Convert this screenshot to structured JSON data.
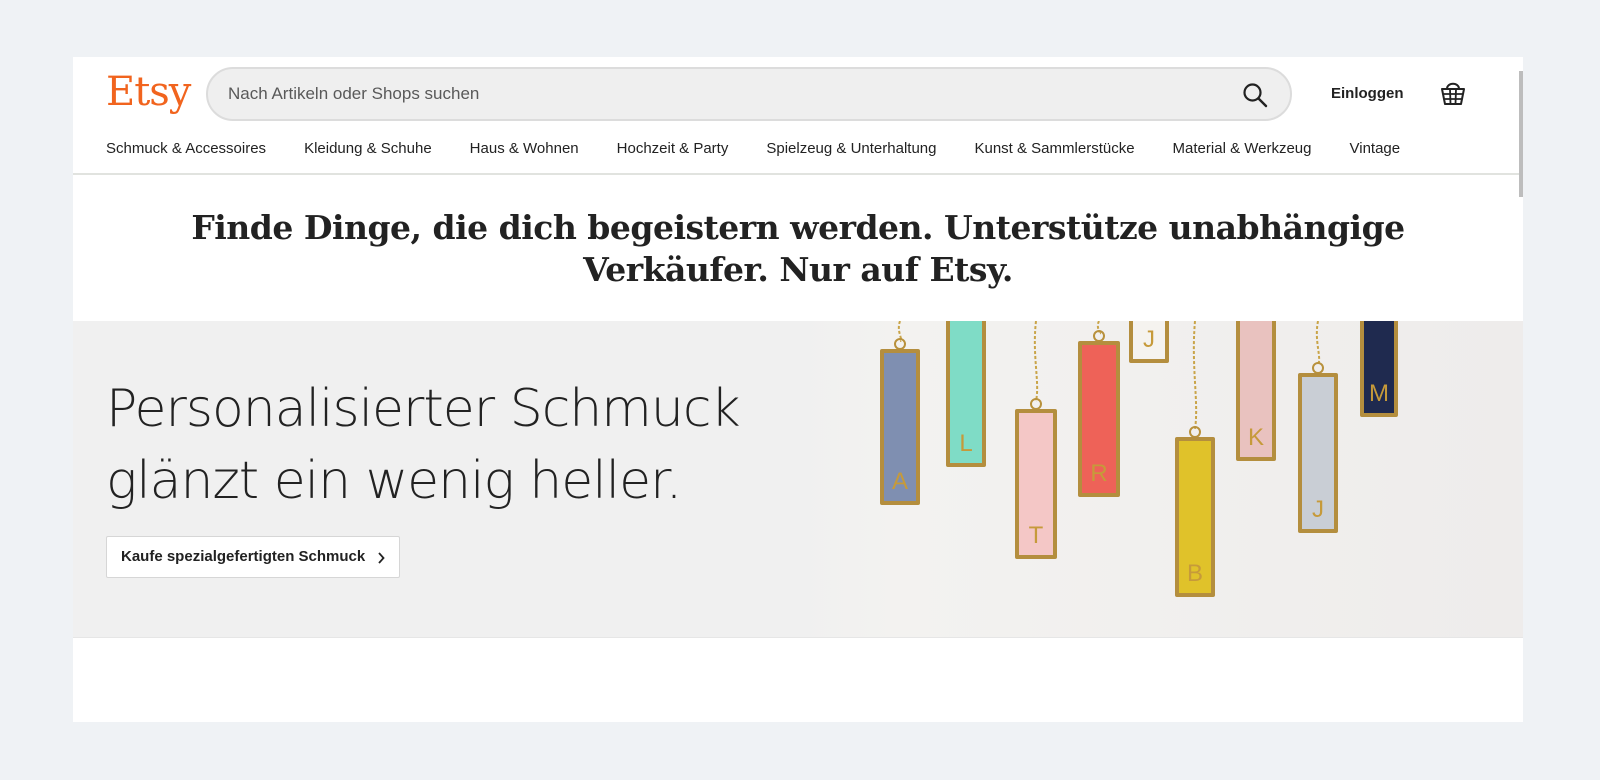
{
  "header": {
    "logo": "Etsy",
    "search": {
      "placeholder": "Nach Artikeln oder Shops suchen",
      "icon": "search-icon"
    },
    "signin_label": "Einloggen",
    "basket_icon": "basket-icon",
    "accent_color": "#f1641e"
  },
  "nav": {
    "items": [
      "Schmuck & Accessoires",
      "Kleidung & Schuhe",
      "Haus & Wohnen",
      "Hochzeit & Party",
      "Spielzeug & Unterhaltung",
      "Kunst & Sammlerstücke",
      "Material & Werkzeug",
      "Vintage"
    ]
  },
  "headline": "Finde Dinge, die dich begeistern werden. Unterstütze unabhängige Verkäufer. Nur auf Etsy.",
  "hero": {
    "title": "Personalisierter Schmuck glänzt ein wenig heller.",
    "cta_label": "Kaufe spezialgefertigten Schmuck",
    "pendants": [
      {
        "letter": "A",
        "color": "#7f8fb1"
      },
      {
        "letter": "L",
        "color": "#7fdcc6"
      },
      {
        "letter": "T",
        "color": "#f4c7c6"
      },
      {
        "letter": "R",
        "color": "#ee6258"
      },
      {
        "letter": "J",
        "color": "#f5f3ef"
      },
      {
        "letter": "B",
        "color": "#e0c22a"
      },
      {
        "letter": "K",
        "color": "#e9c2bf"
      },
      {
        "letter": "J",
        "color": "#c9ced5"
      },
      {
        "letter": "M",
        "color": "#1f2a4f"
      }
    ]
  }
}
